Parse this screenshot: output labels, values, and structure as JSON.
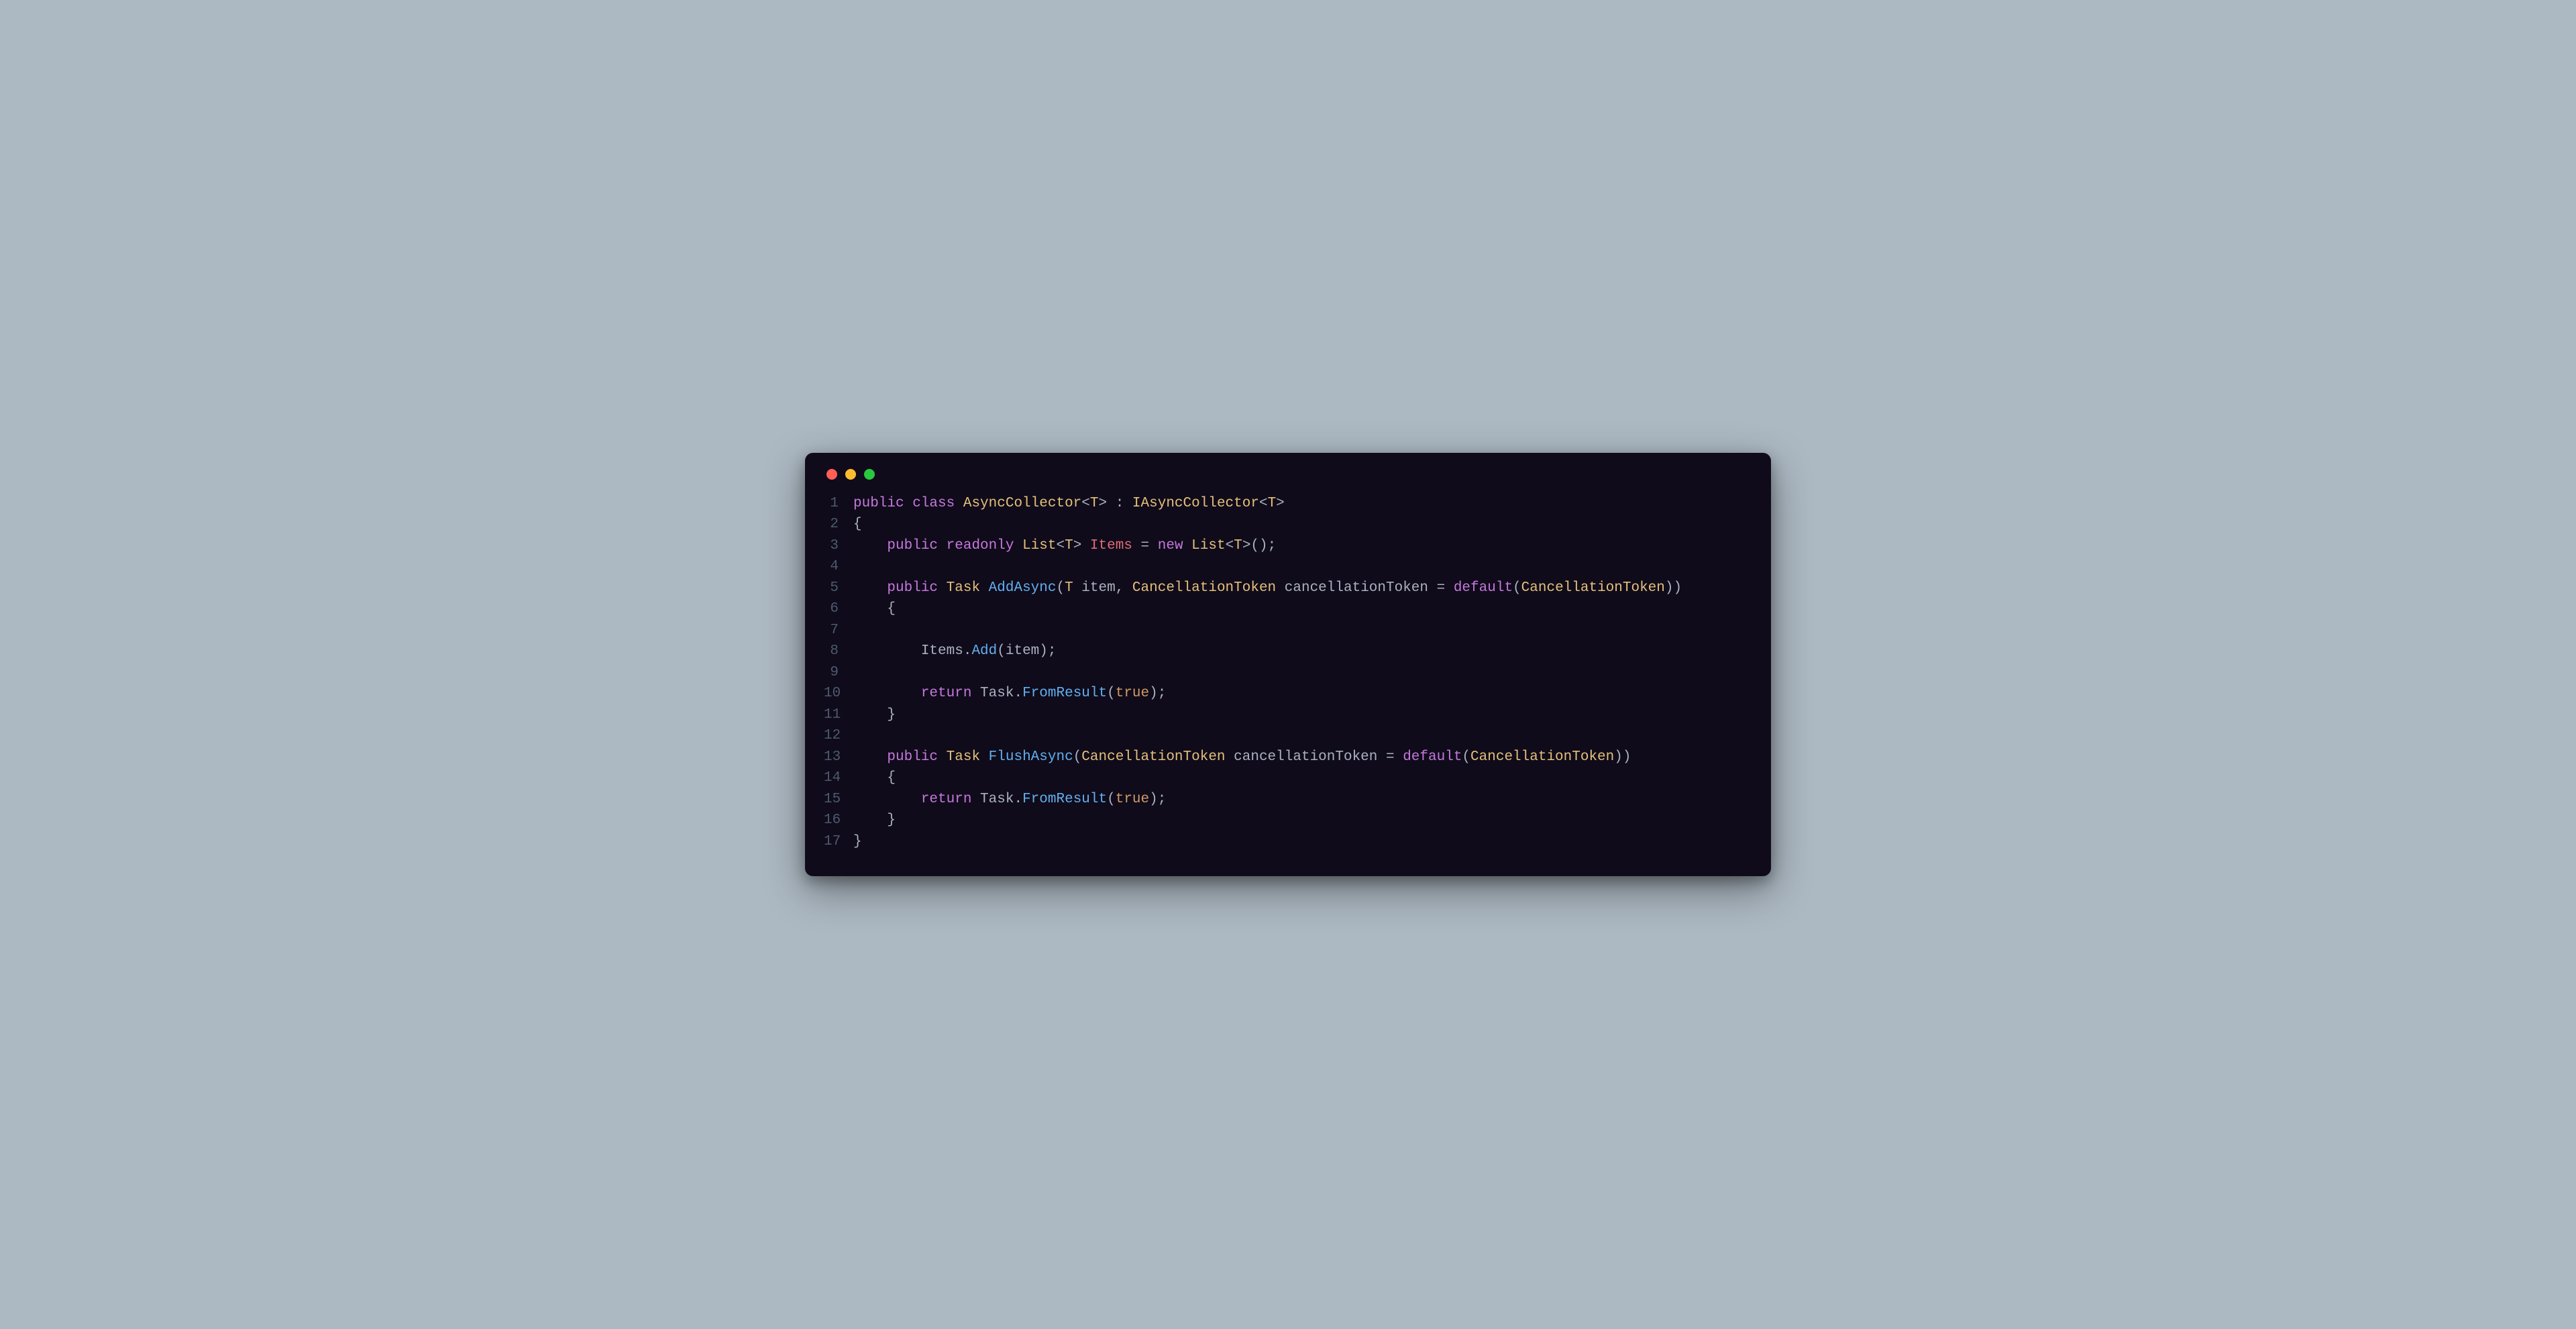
{
  "window": {
    "traffic_lights": [
      "red",
      "yellow",
      "green"
    ]
  },
  "code": {
    "lines": [
      {
        "num": "1",
        "tokens": [
          {
            "t": "public ",
            "c": "tk-keyword"
          },
          {
            "t": "class ",
            "c": "tk-keyword"
          },
          {
            "t": "AsyncCollector",
            "c": "tk-type"
          },
          {
            "t": "<",
            "c": "tk-angle"
          },
          {
            "t": "T",
            "c": "tk-type"
          },
          {
            "t": "> : ",
            "c": "tk-punct"
          },
          {
            "t": "IAsyncCollector",
            "c": "tk-type"
          },
          {
            "t": "<",
            "c": "tk-angle"
          },
          {
            "t": "T",
            "c": "tk-type"
          },
          {
            "t": ">",
            "c": "tk-angle"
          }
        ]
      },
      {
        "num": "2",
        "tokens": [
          {
            "t": "{",
            "c": "tk-punct"
          }
        ]
      },
      {
        "num": "3",
        "tokens": [
          {
            "t": "    ",
            "c": "tk-punct"
          },
          {
            "t": "public ",
            "c": "tk-keyword"
          },
          {
            "t": "readonly ",
            "c": "tk-keyword"
          },
          {
            "t": "List",
            "c": "tk-type"
          },
          {
            "t": "<",
            "c": "tk-angle"
          },
          {
            "t": "T",
            "c": "tk-type"
          },
          {
            "t": "> ",
            "c": "tk-angle"
          },
          {
            "t": "Items",
            "c": "tk-field"
          },
          {
            "t": " = ",
            "c": "tk-punct"
          },
          {
            "t": "new ",
            "c": "tk-keyword"
          },
          {
            "t": "List",
            "c": "tk-type"
          },
          {
            "t": "<",
            "c": "tk-angle"
          },
          {
            "t": "T",
            "c": "tk-type"
          },
          {
            "t": ">();",
            "c": "tk-punct"
          }
        ]
      },
      {
        "num": "4",
        "tokens": [
          {
            "t": "",
            "c": "tk-punct"
          }
        ]
      },
      {
        "num": "5",
        "tokens": [
          {
            "t": "    ",
            "c": "tk-punct"
          },
          {
            "t": "public ",
            "c": "tk-keyword"
          },
          {
            "t": "Task ",
            "c": "tk-type"
          },
          {
            "t": "AddAsync",
            "c": "tk-method"
          },
          {
            "t": "(",
            "c": "tk-punct"
          },
          {
            "t": "T",
            "c": "tk-type"
          },
          {
            "t": " item, ",
            "c": "tk-ident"
          },
          {
            "t": "CancellationToken",
            "c": "tk-type"
          },
          {
            "t": " cancellationToken = ",
            "c": "tk-ident"
          },
          {
            "t": "default",
            "c": "tk-keyword"
          },
          {
            "t": "(",
            "c": "tk-punct"
          },
          {
            "t": "CancellationToken",
            "c": "tk-type"
          },
          {
            "t": "))",
            "c": "tk-punct"
          }
        ]
      },
      {
        "num": "6",
        "tokens": [
          {
            "t": "    {",
            "c": "tk-punct"
          }
        ]
      },
      {
        "num": "7",
        "tokens": [
          {
            "t": "",
            "c": "tk-punct"
          }
        ]
      },
      {
        "num": "8",
        "tokens": [
          {
            "t": "        ",
            "c": "tk-punct"
          },
          {
            "t": "Items",
            "c": "tk-ident"
          },
          {
            "t": ".",
            "c": "tk-punct"
          },
          {
            "t": "Add",
            "c": "tk-method"
          },
          {
            "t": "(item);",
            "c": "tk-punct"
          }
        ]
      },
      {
        "num": "9",
        "tokens": [
          {
            "t": "",
            "c": "tk-punct"
          }
        ]
      },
      {
        "num": "10",
        "tokens": [
          {
            "t": "        ",
            "c": "tk-punct"
          },
          {
            "t": "return ",
            "c": "tk-keyword"
          },
          {
            "t": "Task",
            "c": "tk-ident"
          },
          {
            "t": ".",
            "c": "tk-punct"
          },
          {
            "t": "FromResult",
            "c": "tk-method"
          },
          {
            "t": "(",
            "c": "tk-punct"
          },
          {
            "t": "true",
            "c": "tk-bool"
          },
          {
            "t": ");",
            "c": "tk-punct"
          }
        ]
      },
      {
        "num": "11",
        "tokens": [
          {
            "t": "    }",
            "c": "tk-punct"
          }
        ]
      },
      {
        "num": "12",
        "tokens": [
          {
            "t": "",
            "c": "tk-punct"
          }
        ]
      },
      {
        "num": "13",
        "tokens": [
          {
            "t": "    ",
            "c": "tk-punct"
          },
          {
            "t": "public ",
            "c": "tk-keyword"
          },
          {
            "t": "Task ",
            "c": "tk-type"
          },
          {
            "t": "FlushAsync",
            "c": "tk-method"
          },
          {
            "t": "(",
            "c": "tk-punct"
          },
          {
            "t": "CancellationToken",
            "c": "tk-type"
          },
          {
            "t": " cancellationToken = ",
            "c": "tk-ident"
          },
          {
            "t": "default",
            "c": "tk-keyword"
          },
          {
            "t": "(",
            "c": "tk-punct"
          },
          {
            "t": "CancellationToken",
            "c": "tk-type"
          },
          {
            "t": "))",
            "c": "tk-punct"
          }
        ]
      },
      {
        "num": "14",
        "tokens": [
          {
            "t": "    {",
            "c": "tk-punct"
          }
        ]
      },
      {
        "num": "15",
        "tokens": [
          {
            "t": "        ",
            "c": "tk-punct"
          },
          {
            "t": "return ",
            "c": "tk-keyword"
          },
          {
            "t": "Task",
            "c": "tk-ident"
          },
          {
            "t": ".",
            "c": "tk-punct"
          },
          {
            "t": "FromResult",
            "c": "tk-method"
          },
          {
            "t": "(",
            "c": "tk-punct"
          },
          {
            "t": "true",
            "c": "tk-bool"
          },
          {
            "t": ");",
            "c": "tk-punct"
          }
        ]
      },
      {
        "num": "16",
        "tokens": [
          {
            "t": "    }",
            "c": "tk-punct"
          }
        ]
      },
      {
        "num": "17",
        "tokens": [
          {
            "t": "}",
            "c": "tk-punct"
          }
        ]
      }
    ]
  }
}
